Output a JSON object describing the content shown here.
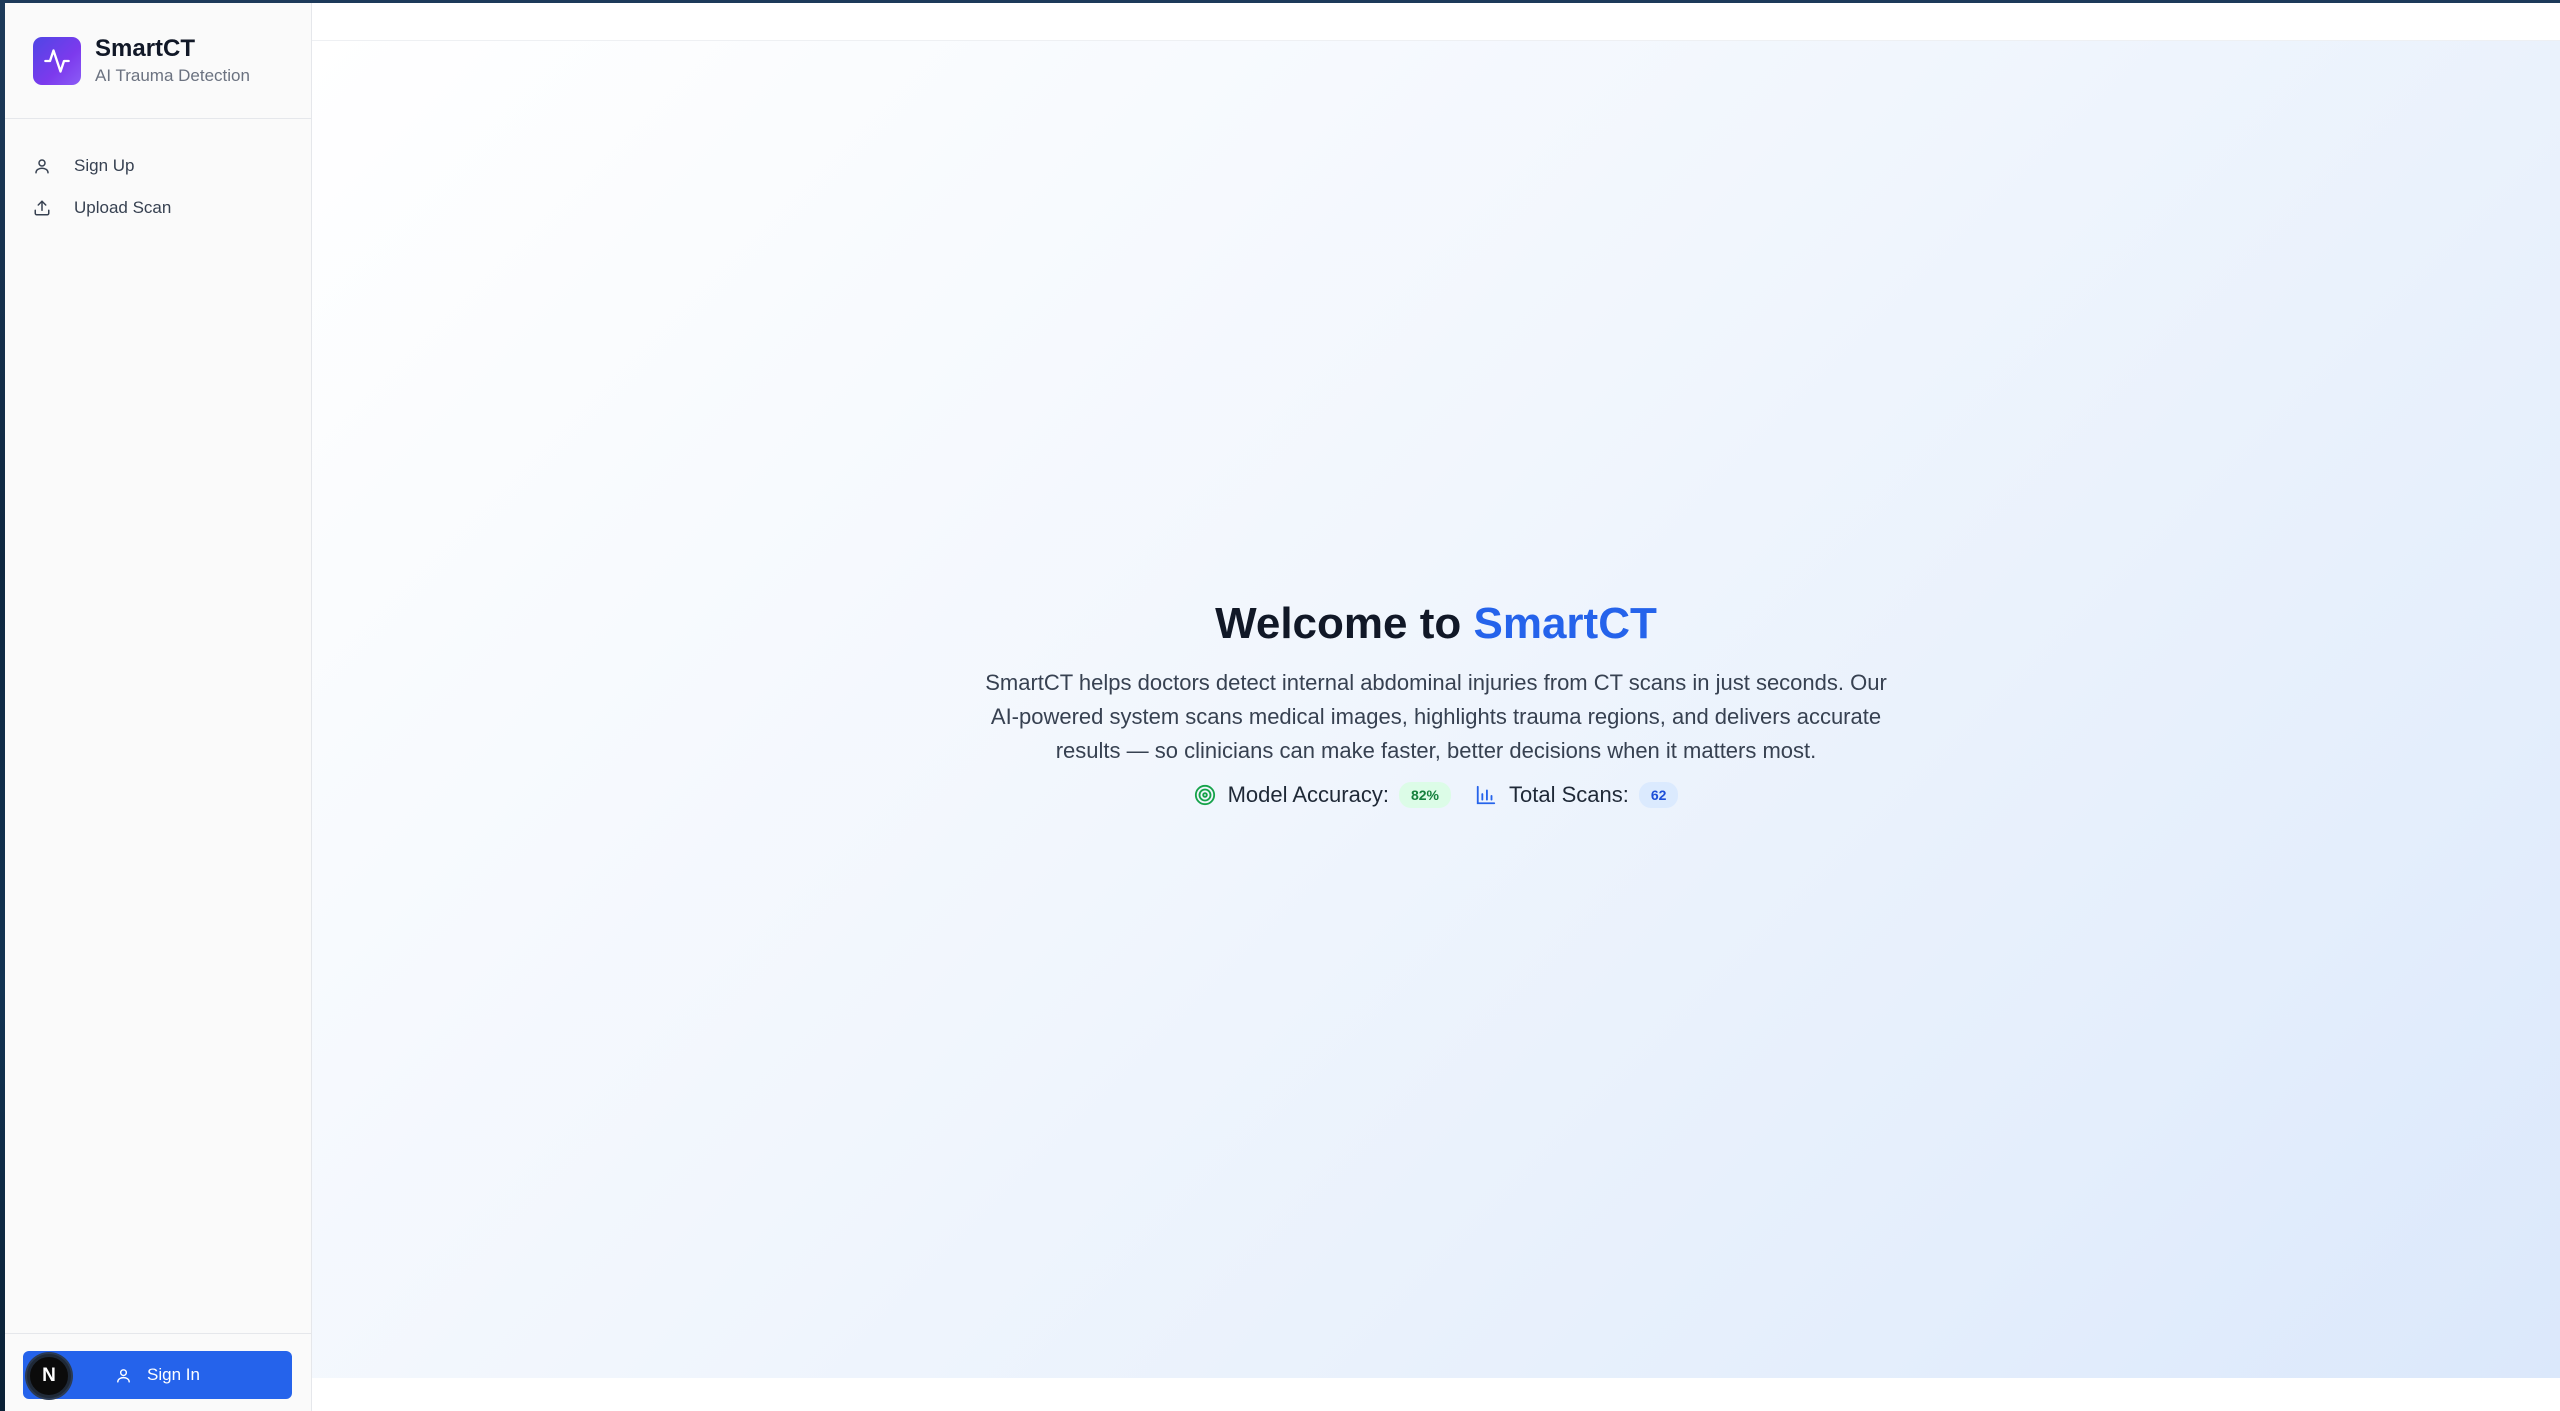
{
  "brand": {
    "name": "SmartCT",
    "subtitle": "AI Trauma Detection",
    "logo_icon": "activity-pulse-icon"
  },
  "nav": {
    "items": [
      {
        "label": "Sign Up",
        "icon": "user-icon"
      },
      {
        "label": "Upload Scan",
        "icon": "upload-icon"
      }
    ]
  },
  "footer": {
    "signin_label": "Sign In",
    "devtools_badge": "N"
  },
  "hero": {
    "title_prefix": "Welcome to",
    "title_accent": "SmartCT",
    "description": "SmartCT helps doctors detect internal abdominal injuries from CT scans in just seconds. Our AI-powered system scans medical images, highlights trauma regions, and delivers accurate results — so clinicians can make faster, better decisions when it matters most."
  },
  "stats": {
    "accuracy_label": "Model Accuracy:",
    "accuracy_value": "82%",
    "scans_label": "Total Scans:",
    "scans_value": "62"
  },
  "colors": {
    "accent": "#2563eb",
    "logo_gradient_start": "#4f46e5",
    "logo_gradient_end": "#8b5cf6",
    "accuracy_pill_bg": "#dcfce7",
    "scans_pill_bg": "#dbeafe"
  }
}
